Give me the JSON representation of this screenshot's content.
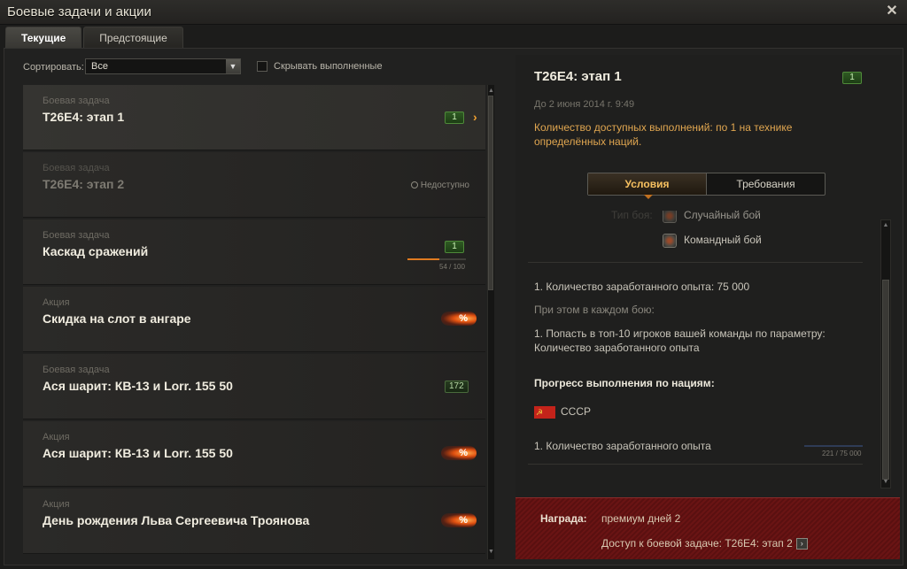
{
  "window": {
    "title": "Боевые задачи и акции",
    "close_icon": "close-icon"
  },
  "tabs": [
    {
      "label": "Текущие",
      "active": true
    },
    {
      "label": "Предстоящие",
      "active": false
    }
  ],
  "filter": {
    "sort_label": "Сортировать:",
    "sort_value": "Все",
    "hide_completed_label": "Скрывать выполненные",
    "hide_completed_checked": false
  },
  "list": [
    {
      "type": "Боевая задача",
      "name": "T26E4: этап 1",
      "badge": "1",
      "selected": true
    },
    {
      "type": "Боевая задача",
      "name": "T26E4: этап 2",
      "status": "Недоступно"
    },
    {
      "type": "Боевая задача",
      "name": "Каскад сражений",
      "badge": "1",
      "progress": 54,
      "progress_max": 100,
      "progress_text": "54 / 100"
    },
    {
      "type": "Акция",
      "name": "Скидка на слот в ангаре",
      "promo": "%"
    },
    {
      "type": "Боевая задача",
      "name": "Ася шарит: КВ-13 и Lorr. 155 50",
      "badge": "172"
    },
    {
      "type": "Акция",
      "name": "Ася шарит: КВ-13 и Lorr. 155 50",
      "promo": "%"
    },
    {
      "type": "Акция",
      "name": "День рождения Льва Сергеевича Троянова",
      "promo": "%"
    }
  ],
  "detail": {
    "title": "T26E4: этап 1",
    "badge": "1",
    "date": "До 2 июня 2014 г. 9:49",
    "description": "Количество доступных выполнений: по 1 на технике определённых наций.",
    "subtabs": [
      {
        "label": "Условия",
        "active": true
      },
      {
        "label": "Требования",
        "active": false
      }
    ],
    "battle_type_label": "Тип боя:",
    "battle_types": [
      "Случайный бой",
      "Командный бой"
    ],
    "condition_1": "1. Количество заработанного опыта:  75 000",
    "each_battle_label": "При этом в каждом бою:",
    "condition_2": "1. Попасть в топ-10 игроков вашей команды по параметру: Количество заработанного опыта",
    "nation_progress_title": "Прогресс выполнения по нациям:",
    "nation": "СССР",
    "nation_condition": "1. Количество заработанного опыта",
    "nation_progress": 221,
    "nation_progress_max": 75000,
    "nation_progress_text": "221 / 75 000"
  },
  "reward": {
    "label": "Награда:",
    "value": "премиум дней 2",
    "access": "Доступ к боевой задаче: T26E4: этап 2"
  },
  "colors": {
    "accent_orange": "#e0a650",
    "badge_green": "#4f8a3a",
    "reward_red": "#6a1414",
    "progress_orange": "#e07a20"
  }
}
